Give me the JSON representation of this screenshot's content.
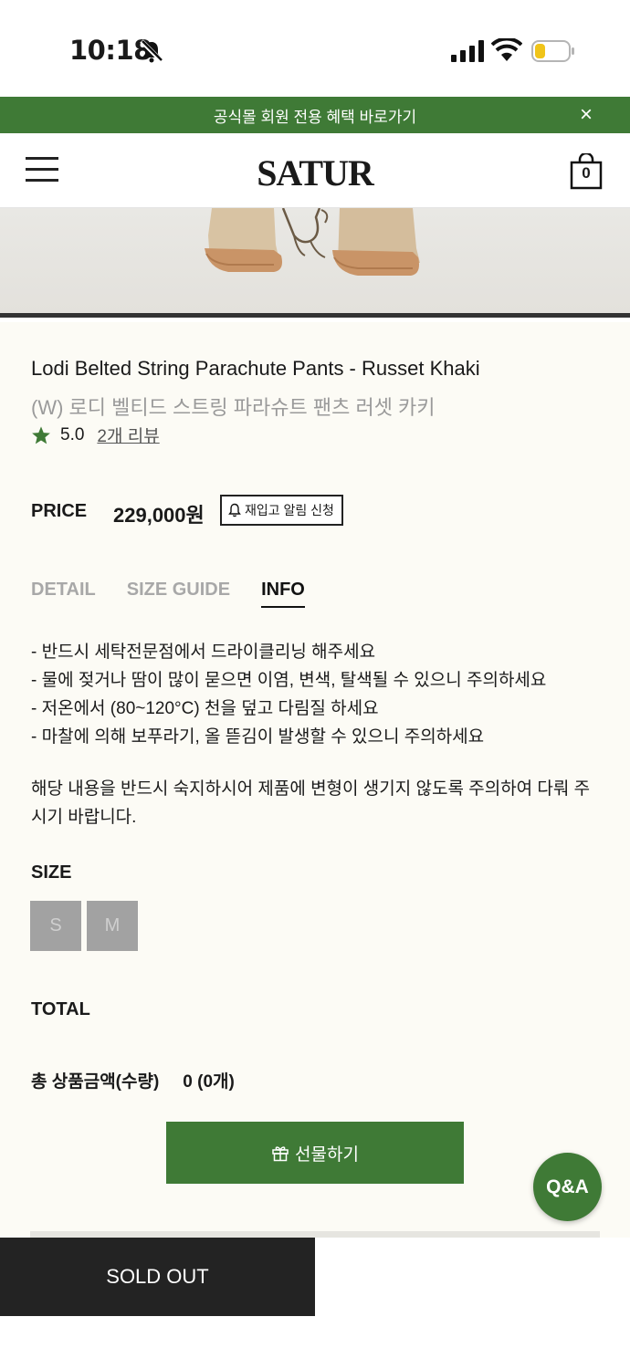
{
  "status_bar": {
    "time": "10:18"
  },
  "promo": {
    "text": "공식몰 회원 전용 혜택 바로가기",
    "close": "×"
  },
  "header": {
    "logo": "SATUR",
    "cart_count": "0"
  },
  "product": {
    "title_en": "Lodi Belted String Parachute Pants - Russet Khaki",
    "title_ko": "(W) 로디 벨티드 스트링 파라슈트 팬츠 러셋 카키",
    "rating": "5.0",
    "reviews_link": "2개 리뷰"
  },
  "price": {
    "label": "PRICE",
    "value": "229,000원",
    "restock_button": "재입고 알림 신청"
  },
  "tabs": [
    {
      "label": "DETAIL",
      "active": false
    },
    {
      "label": "SIZE GUIDE",
      "active": false
    },
    {
      "label": "INFO",
      "active": true
    }
  ],
  "info": {
    "lines": [
      "- 반드시 세탁전문점에서 드라이클리닝 해주세요",
      "- 물에 젖거나 땀이 많이 묻으면 이염, 변색, 탈색될 수 있으니 주의하세요",
      "- 저온에서 (80~120°C) 천을 덮고 다림질 하세요",
      "- 마찰에 의해 보푸라기, 올 뜯김이 발생할 수 있으니 주의하세요"
    ],
    "notice": "해당 내용을 반드시 숙지하시어 제품에 변형이 생기지 않도록 주의하여 다뤄 주시기 바랍니다."
  },
  "size": {
    "label": "SIZE",
    "options": [
      "S",
      "M"
    ]
  },
  "total": {
    "label": "TOTAL",
    "sum_label": "총 상품금액(수량)",
    "sum_value": "0 (0개)"
  },
  "gift_button": "선물하기",
  "qna_button": "Q&A",
  "bottom_bar": {
    "soldout": "SOLD OUT"
  },
  "colors": {
    "brand_green": "#3f7a36",
    "dark": "#232323",
    "page_bg": "#fcfbf5"
  },
  "icons": [
    "mute-icon",
    "signal-icon",
    "wifi-icon",
    "battery-icon",
    "menu-icon",
    "cart-icon",
    "star-icon",
    "bell-icon",
    "gift-icon",
    "close-icon"
  ]
}
